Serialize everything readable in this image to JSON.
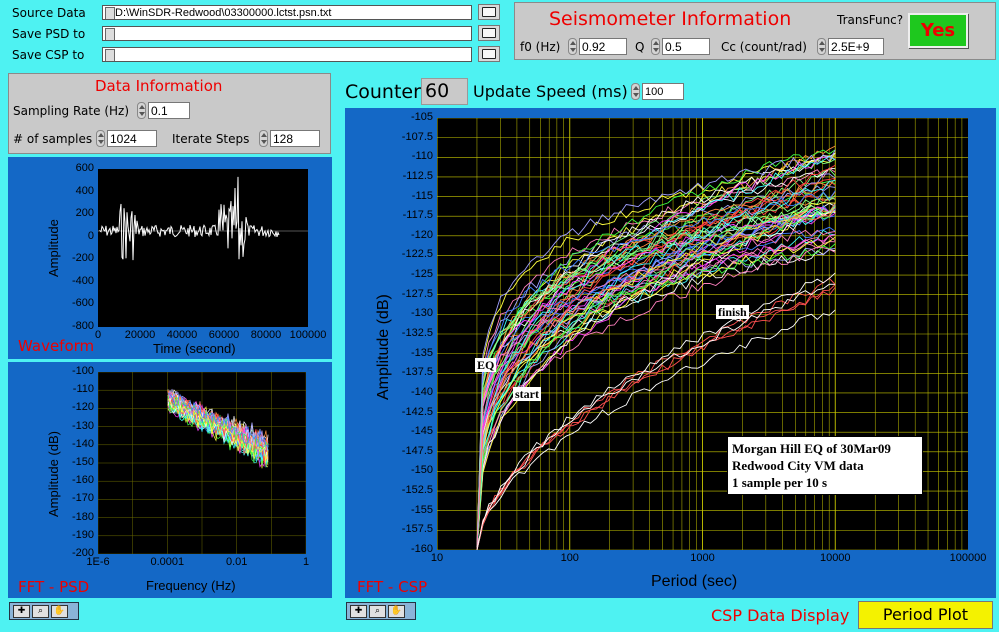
{
  "files": {
    "source_label": "Source Data",
    "source_path": "D:\\WinSDR-Redwood\\03300000.lctst.psn.txt",
    "save_psd_label": "Save PSD to",
    "save_psd_path": "",
    "save_csp_label": "Save CSP to",
    "save_csp_path": "",
    "path_prefix": "%"
  },
  "seismometer": {
    "title": "Seismometer Information",
    "transfunc_label": "TransFunc?",
    "transfunc_value": "Yes",
    "f0_label": "f0 (Hz)",
    "f0_value": "0.92",
    "q_label": "Q",
    "q_value": "0.5",
    "cc_label": "Cc (count/rad)",
    "cc_value": "2.5E+9"
  },
  "data_info": {
    "title": "Data Information",
    "sampling_rate_label": "Sampling Rate (Hz)",
    "sampling_rate_value": "0.1",
    "samples_label": "# of samples",
    "samples_value": "1024",
    "iterate_label": "Iterate Steps",
    "iterate_value": "128"
  },
  "counter": {
    "label": "Counter",
    "value": "60",
    "update_label": "Update Speed (ms)",
    "update_value": "100"
  },
  "waveform": {
    "panel_label": "Waveform",
    "ylabel": "Amplitude",
    "xlabel": "Time (second)",
    "yticks": [
      "600",
      "400",
      "200",
      "0",
      "-200",
      "-400",
      "-600",
      "-800"
    ],
    "xticks": [
      "0",
      "20000",
      "40000",
      "60000",
      "80000",
      "100000"
    ]
  },
  "psd": {
    "panel_label": "FFT - PSD",
    "ylabel": "Amplitude (dB)",
    "xlabel": "Frequency (Hz)",
    "yticks": [
      "-100",
      "-110",
      "-120",
      "-130",
      "-140",
      "-150",
      "-160",
      "-170",
      "-180",
      "-190",
      "-200"
    ],
    "xticks": [
      "1E-6",
      "0.0001",
      "0.01",
      "1"
    ]
  },
  "csp": {
    "panel_label": "FFT - CSP",
    "ylabel": "Amplitude (dB)",
    "xlabel": "Period (sec)",
    "yticks": [
      "-105",
      "-107.5",
      "-110",
      "-112.5",
      "-115",
      "-117.5",
      "-120",
      "-122.5",
      "-125",
      "-127.5",
      "-130",
      "-132.5",
      "-135",
      "-137.5",
      "-140",
      "-142.5",
      "-145",
      "-147.5",
      "-150",
      "-152.5",
      "-155",
      "-157.5",
      "-160"
    ],
    "xticks": [
      "10",
      "100",
      "1000",
      "10000",
      "100000"
    ],
    "label_eq": "EQ",
    "label_start": "start",
    "label_finish": "finish",
    "info_text": "Morgan Hill EQ of 30Mar09\nRedwood City VM data\n1 sample per 10 s"
  },
  "bottom": {
    "csp_display_label": "CSP Data Display",
    "csp_display_value": "Period Plot"
  },
  "chart_data": [
    {
      "type": "line",
      "title": "",
      "xlabel": "Time (second)",
      "ylabel": "Amplitude",
      "xlim": [
        0,
        100000
      ],
      "ylim": [
        -800,
        600
      ],
      "series": [
        {
          "values_note_x": [
            0,
            86000
          ],
          "x": [
            0,
            86000
          ],
          "values": [
            0,
            0
          ]
        }
      ]
    },
    {
      "type": "line",
      "title": "",
      "xlabel": "Frequency (Hz)",
      "ylabel": "Amplitude (dB)",
      "xscale": "log",
      "xlim": [
        1e-06,
        1
      ],
      "ylim": [
        -200,
        -100
      ]
    },
    {
      "type": "line",
      "title": "",
      "xlabel": "Period (sec)",
      "ylabel": "Amplitude (dB)",
      "xscale": "log",
      "xlim": [
        10,
        100000
      ],
      "ylim": [
        -160,
        -105
      ],
      "grid": true
    }
  ],
  "colors": {
    "background": "#4ef2f2",
    "panel_blue": "#1468c6",
    "title_red": "#ee0000",
    "yes_green": "#1ec81e",
    "period_yellow": "#f4f200",
    "grid": "#c8c800"
  }
}
